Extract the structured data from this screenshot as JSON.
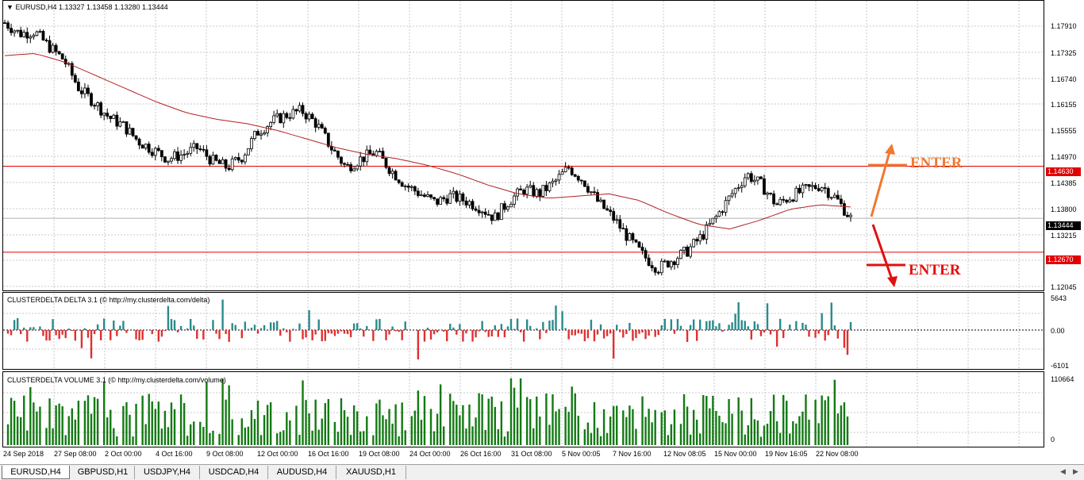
{
  "main_panel": {
    "title": "EURUSD,H4  1.13327 1.13458 1.13280 1.13444",
    "price_labels": [
      "1.17910",
      "1.17325",
      "1.16740",
      "1.16155",
      "1.15555",
      "1.14970",
      "1.14385",
      "1.13800",
      "1.13215",
      "1.12045"
    ],
    "resistance_level": "1.14630",
    "support_level": "1.12670",
    "current_price": "1.13444",
    "enter_labels": [
      "ENTER",
      "ENTER"
    ]
  },
  "delta_panel": {
    "title": "CLUSTERDELTA DELTA 3.1 (© http://my.clusterdelta.com/delta)",
    "scale_labels": [
      "5643",
      "0.00",
      "-6101"
    ]
  },
  "volume_panel": {
    "title": "CLUSTERDELTA VOLUME 3.1 (© http://my.clusterdelta.com/volume)",
    "scale_labels": [
      "110664",
      "0"
    ]
  },
  "time_labels": [
    "24 Sep 2018",
    "27 Sep 08:00",
    "2 Oct 00:00",
    "4 Oct 16:00",
    "9 Oct 08:00",
    "12 Oct 00:00",
    "16 Oct 16:00",
    "19 Oct 08:00",
    "24 Oct 00:00",
    "26 Oct 16:00",
    "31 Oct 08:00",
    "5 Nov 00:05",
    "7 Nov 16:00",
    "12 Nov 08:05",
    "15 Nov 00:00",
    "19 Nov 16:05",
    "22 Nov 08:00"
  ],
  "tabs": [
    "EURUSD,H4",
    "GBPUSD,H1",
    "USDJPY,H4",
    "USDCAD,H4",
    "AUDUSD,H4",
    "XAUUSD,H1"
  ],
  "colors": {
    "bullish": "#000000",
    "bearish": "#000000",
    "moving_average": "#b22222",
    "level_line": "#e00000",
    "delta_positive": "#2a8a8a",
    "delta_negative": "#e03030",
    "volume_bar": "#137a13",
    "arrow_up": "#f07830",
    "arrow_down": "#e01010"
  },
  "chart_data": {
    "type": "candlestick",
    "symbol": "EURUSD",
    "timeframe": "H4",
    "ylim": [
      1.118,
      1.184
    ],
    "ohlc_close_approx": [
      1.179,
      1.1765,
      1.177,
      1.1735,
      1.1705,
      1.164,
      1.161,
      1.1575,
      1.1555,
      1.152,
      1.15,
      1.148,
      1.149,
      1.1505,
      1.1475,
      1.146,
      1.1485,
      1.154,
      1.1565,
      1.158,
      1.159,
      1.156,
      1.1505,
      1.146,
      1.148,
      1.1495,
      1.1455,
      1.142,
      1.14,
      1.138,
      1.1395,
      1.1385,
      1.137,
      1.1345,
      1.1385,
      1.141,
      1.14,
      1.1425,
      1.146,
      1.143,
      1.138,
      1.1345,
      1.13,
      1.126,
      1.123,
      1.125,
      1.127,
      1.1305,
      1.135,
      1.14,
      1.1445,
      1.142,
      1.1375,
      1.1395,
      1.141,
      1.142,
      1.139,
      1.1345
    ],
    "moving_average_approx": [
      1.1715,
      1.172,
      1.17,
      1.167,
      1.164,
      1.161,
      1.1585,
      1.157,
      1.156,
      1.1545,
      1.1525,
      1.1505,
      1.149,
      1.148,
      1.1465,
      1.1445,
      1.142,
      1.14,
      1.139,
      1.1395,
      1.14,
      1.1385,
      1.1355,
      1.133,
      1.132,
      1.134,
      1.1365,
      1.1375,
      1.137
    ],
    "horizontal_lines": [
      1.1463,
      1.1267
    ]
  }
}
